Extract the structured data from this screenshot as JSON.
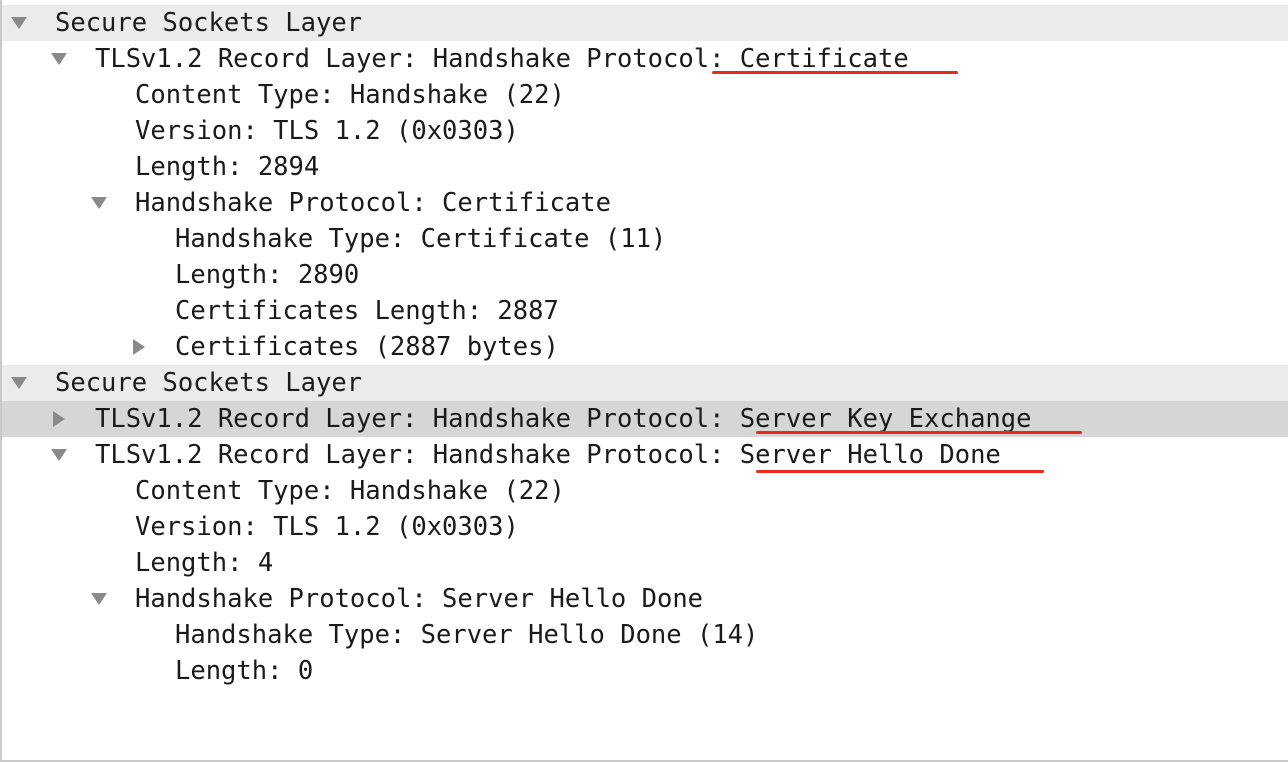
{
  "packet_details": {
    "rows": [
      {
        "label": "Secure Sockets Layer",
        "level": 0,
        "expander": "expanded",
        "section": true
      },
      {
        "label": "TLSv1.2 Record Layer: Handshake Protocol: Certificate",
        "level": 1,
        "expander": "expanded"
      },
      {
        "label": "Content Type: Handshake (22)",
        "level": 2,
        "expander": "none"
      },
      {
        "label": "Version: TLS 1.2 (0x0303)",
        "level": 2,
        "expander": "none"
      },
      {
        "label": "Length: 2894",
        "level": 2,
        "expander": "none"
      },
      {
        "label": "Handshake Protocol: Certificate",
        "level": 2,
        "expander": "expanded"
      },
      {
        "label": "Handshake Type: Certificate (11)",
        "level": 3,
        "expander": "none"
      },
      {
        "label": "Length: 2890",
        "level": 3,
        "expander": "none"
      },
      {
        "label": "Certificates Length: 2887",
        "level": 3,
        "expander": "none"
      },
      {
        "label": "Certificates (2887 bytes)",
        "level": 3,
        "expander": "collapsed"
      },
      {
        "label": "Secure Sockets Layer",
        "level": 0,
        "expander": "expanded",
        "section": true
      },
      {
        "label": "TLSv1.2 Record Layer: Handshake Protocol: Server Key Exchange",
        "level": 1,
        "expander": "collapsed",
        "selected": true
      },
      {
        "label": "TLSv1.2 Record Layer: Handshake Protocol: Server Hello Done",
        "level": 1,
        "expander": "expanded"
      },
      {
        "label": "Content Type: Handshake (22)",
        "level": 2,
        "expander": "none"
      },
      {
        "label": "Version: TLS 1.2 (0x0303)",
        "level": 2,
        "expander": "none"
      },
      {
        "label": "Length: 4",
        "level": 2,
        "expander": "none"
      },
      {
        "label": "Handshake Protocol: Server Hello Done",
        "level": 2,
        "expander": "expanded"
      },
      {
        "label": "Handshake Type: Server Hello Done (14)",
        "level": 3,
        "expander": "none"
      },
      {
        "label": "Length: 0",
        "level": 3,
        "expander": "none"
      }
    ]
  },
  "colors": {
    "section_background": "#ebebeb",
    "selected_background": "#d6d6d6",
    "text": "#1a1a1a",
    "expander": "#8a8a8a",
    "annotation_underline": "#e8291c"
  },
  "icons": {
    "expanded": "triangle-down-icon",
    "collapsed": "triangle-right-icon"
  }
}
